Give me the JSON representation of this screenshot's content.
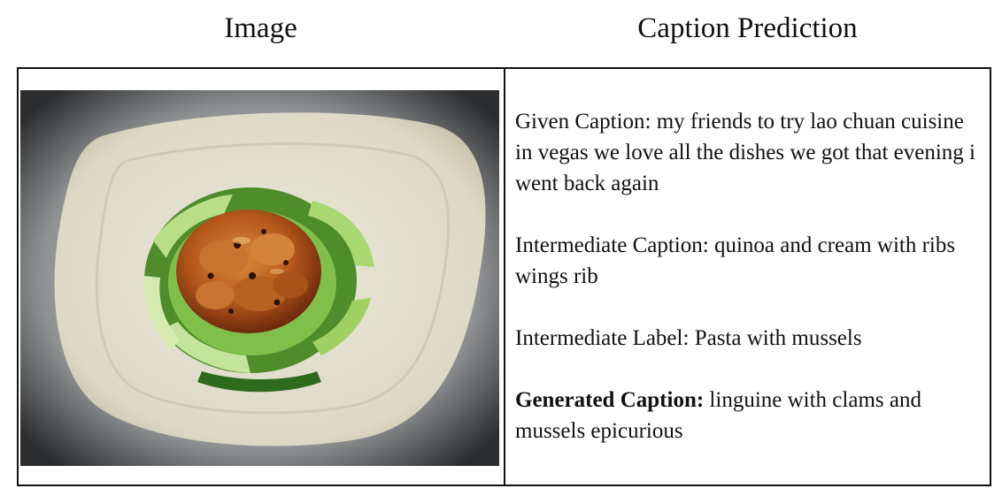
{
  "headers": {
    "image": "Image",
    "caption": "Caption Prediction"
  },
  "photo": {
    "subject": "plate of glazed chicken pieces surrounded by bok choy on a white square plate"
  },
  "captions": {
    "given_label": "Given Caption:",
    "given_text": "my friends to try lao chuan cuisine in vegas we love all the dishes we got that evening i went back again",
    "intermediate_caption_label": "Intermediate Caption:",
    "intermediate_caption_text": "quinoa and cream with ribs wings rib",
    "intermediate_label_label": "Intermediate Label:",
    "intermediate_label_text": "Pasta with mussels",
    "generated_label": "Generated Caption:",
    "generated_text": "linguine with clams and mussels epicurious"
  }
}
